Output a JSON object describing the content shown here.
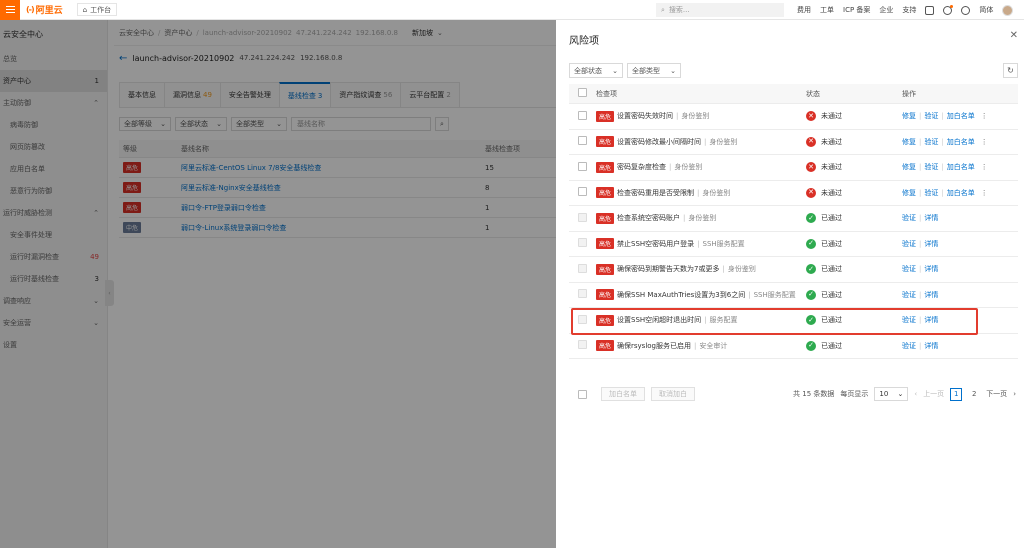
{
  "topbar": {
    "logo_mark": "(-)",
    "logo_text": "阿里云",
    "workbench": "工作台",
    "search_placeholder": "搜索...",
    "links": [
      "费用",
      "工单",
      "ICP 备案",
      "企业",
      "支持"
    ],
    "language": "简体"
  },
  "sidebar": {
    "title": "云安全中心",
    "items": [
      {
        "label": "总览",
        "count": ""
      },
      {
        "label": "资产中心",
        "count": "1"
      },
      {
        "label": "主动防御",
        "count": ""
      },
      {
        "label": "病毒防御",
        "count": ""
      },
      {
        "label": "网页防篡改",
        "count": ""
      },
      {
        "label": "应用白名单",
        "count": ""
      },
      {
        "label": "恶意行为防御",
        "count": ""
      },
      {
        "label": "运行时威胁检测",
        "count": ""
      },
      {
        "label": "安全事件处理",
        "count": ""
      },
      {
        "label": "运行时漏洞检查",
        "count": "49"
      },
      {
        "label": "运行时基线检查",
        "count": "3"
      },
      {
        "label": "调查响应",
        "count": ""
      },
      {
        "label": "安全运营",
        "count": ""
      },
      {
        "label": "设置",
        "count": ""
      }
    ]
  },
  "main": {
    "breadcrumb": [
      "云安全中心",
      "资产中心",
      "launch-advisor-20210902",
      "47.241.224.242",
      "192.168.0.8"
    ],
    "breadcrumb_dropdown": "新加坡",
    "asset_name": "launch-advisor-20210902",
    "asset_ip1": "47.241.224.242",
    "asset_ip2": "192.168.0.8",
    "tabs": [
      {
        "label": "基本信息",
        "num": ""
      },
      {
        "label": "漏洞信息",
        "num": "49"
      },
      {
        "label": "安全告警处理",
        "num": ""
      },
      {
        "label": "基线检查",
        "num": "3"
      },
      {
        "label": "资产指纹调查",
        "num": "56"
      },
      {
        "label": "云平台配置",
        "num": "2"
      }
    ],
    "filters": [
      "全部等级",
      "全部状态",
      "全部类型"
    ],
    "filter_input": "基线名称",
    "table_headers": [
      "等级",
      "基线名称",
      "基线检查项"
    ],
    "rows": [
      {
        "level": "高危",
        "name": "阿里云标准-CentOS Linux 7/8安全基线检查",
        "count": "15"
      },
      {
        "level": "高危",
        "name": "阿里云标准-Nginx安全基线检查",
        "count": "8"
      },
      {
        "level": "高危",
        "name": "弱口令-FTP登录弱口令检查",
        "count": "1"
      },
      {
        "level": "中危",
        "name": "弱口令-Linux系统登录弱口令检查",
        "count": "1"
      }
    ]
  },
  "drawer": {
    "title": "风险项",
    "filters": [
      "全部状态",
      "全部类型"
    ],
    "headers": [
      "检查项",
      "状态",
      "操作"
    ],
    "rows": [
      {
        "level": "高危",
        "name": "设置密码失效时间",
        "category": "身份鉴别",
        "status": "未通过",
        "actions": [
          "修复",
          "验证",
          "加白名单"
        ]
      },
      {
        "level": "高危",
        "name": "设置密码修改最小间隔时间",
        "category": "身份鉴别",
        "status": "未通过",
        "actions": [
          "修复",
          "验证",
          "加白名单"
        ]
      },
      {
        "level": "高危",
        "name": "密码复杂度检查",
        "category": "身份鉴别",
        "status": "未通过",
        "actions": [
          "修复",
          "验证",
          "加白名单"
        ]
      },
      {
        "level": "高危",
        "name": "检查密码重用是否受限制",
        "category": "身份鉴别",
        "status": "未通过",
        "actions": [
          "修复",
          "验证",
          "加白名单"
        ]
      },
      {
        "level": "高危",
        "name": "检查系统空密码账户",
        "category": "身份鉴别",
        "status": "已通过",
        "actions": [
          "验证",
          "详情"
        ]
      },
      {
        "level": "高危",
        "name": "禁止SSH空密码用户登录",
        "category": "SSH服务配置",
        "status": "已通过",
        "actions": [
          "验证",
          "详情"
        ]
      },
      {
        "level": "高危",
        "name": "确保密码到期警告天数为7或更多",
        "category": "身份鉴别",
        "status": "已通过",
        "actions": [
          "验证",
          "详情"
        ]
      },
      {
        "level": "高危",
        "name": "确保SSH MaxAuthTries设置为3到6之间",
        "category": "SSH服务配置",
        "status": "已通过",
        "actions": [
          "验证",
          "详情"
        ]
      },
      {
        "level": "高危",
        "name": "设置SSH空闲超时退出时间",
        "category": "服务配置",
        "status": "已通过",
        "actions": [
          "验证",
          "详情"
        ]
      },
      {
        "level": "高危",
        "name": "确保rsyslog服务已启用",
        "category": "安全审计",
        "status": "已通过",
        "actions": [
          "验证",
          "详情"
        ]
      }
    ],
    "footer": {
      "btn_whitelist": "加白名单",
      "btn_cancel": "取消加白",
      "total": "共 15 条数据",
      "per_page_label": "每页显示",
      "per_page": "10",
      "prev": "上一页",
      "pages": [
        "1",
        "2"
      ],
      "current_page": "1",
      "next": "下一页"
    }
  },
  "colors": {
    "brand": "#ff6a00",
    "link": "#0070cc",
    "high": "#d93026",
    "pass": "#2eaa4f",
    "highlight": "#e23c2e"
  }
}
